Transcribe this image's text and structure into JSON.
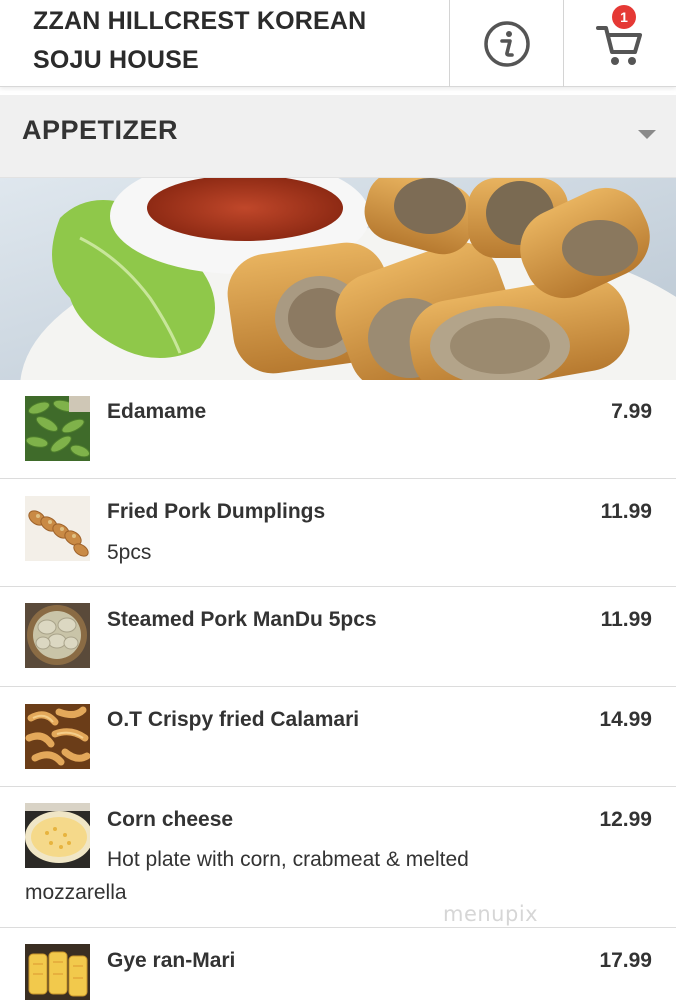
{
  "header": {
    "title_line1": "ZZAN HILLCREST KOREAN",
    "title_line2": "SOJU HOUSE",
    "info_icon": "info-circle-icon",
    "cart_icon": "shopping-cart-icon",
    "cart_count": "1"
  },
  "category": {
    "label": "APPETIZER",
    "caret_icon": "caret-down-icon"
  },
  "hero": {
    "image": "spring-rolls-with-dipping-sauce-photo"
  },
  "items": [
    {
      "name": "Edamame",
      "price": "7.99",
      "desc": "",
      "desc2": "",
      "thumb": "edamame-photo"
    },
    {
      "name": "Fried Pork Dumplings",
      "price": "11.99",
      "desc": "5pcs",
      "desc2": "",
      "thumb": "fried-dumplings-photo"
    },
    {
      "name": "Steamed Pork ManDu 5pcs",
      "price": "11.99",
      "desc": "",
      "desc2": "",
      "thumb": "steamed-dumplings-photo"
    },
    {
      "name": "O.T Crispy fried Calamari",
      "price": "14.99",
      "desc": "",
      "desc2": "",
      "thumb": "fried-calamari-photo"
    },
    {
      "name": "Corn cheese",
      "price": "12.99",
      "desc": "Hot plate with corn, crabmeat & melted",
      "desc2": "mozzarella",
      "thumb": "corn-cheese-photo"
    },
    {
      "name": "Gye ran-Mari",
      "price": "17.99",
      "desc": "",
      "desc2": "",
      "thumb": "rolled-omelette-photo"
    }
  ],
  "watermark": "menupix",
  "colors": {
    "badge": "#e53935",
    "category_bg": "#f0f0f0",
    "text": "#333333"
  }
}
